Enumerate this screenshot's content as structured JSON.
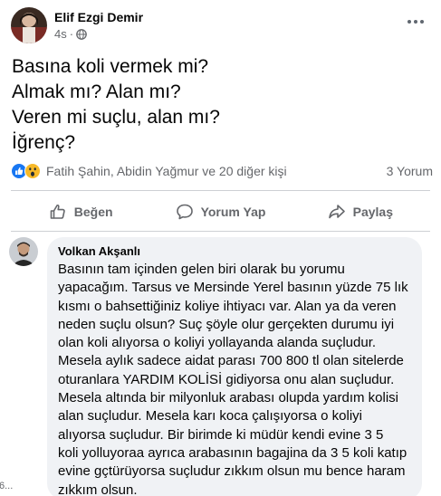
{
  "post": {
    "author": "Elif Ezgi Demir",
    "time": "4s",
    "separator": "·",
    "text_lines": [
      "Basına koli vermek mi?",
      "Almak mı? Alan mı?",
      "Veren mi suçlu, alan mı?",
      "İğrenç?"
    ]
  },
  "reactions": {
    "icons": [
      "like-reaction-icon",
      "wow-reaction-icon"
    ],
    "summary": "Fatih Şahin, Abidin Yağmur ve 20 diğer kişi",
    "comment_count": "3 Yorum"
  },
  "actions": {
    "like": "Beğen",
    "comment": "Yorum Yap",
    "share": "Paylaş"
  },
  "comment": {
    "author": "Volkan Akşanlı",
    "lines": [
      "Basının tam içinden gelen biri olarak bu yorumu",
      "yapacağım. Tarsus ve Mersinde Yerel basının yüzde 75 lık",
      "kısmı o bahsettiğiniz koliye ihtiyacı var. Alan ya da veren",
      "neden suçlu olsun? Suç şöyle olur gerçekten durumu iyi",
      "olan koli alıyorsa o koliyi yollayanda alanda suçludur.",
      "Mesela aylık sadece aidat parası 700 800 tl olan sitelerde",
      "oturanlara YARDIM KOLİSİ gidiyorsa onu alan suçludur.",
      "Mesela altında bir milyonluk arabası olupda yardım kolisi",
      "alan suçludur. Mesela karı koca çalışıyorsa o koliyi",
      "alıyorsa suçludur. Bir birimde ki müdür kendi evine 3 5",
      "koli yolluyoraa ayrıca arabasının bagajina da 3 5 koli katıp",
      "evine gçtürüyorsa suçludur zıkkım olsun mu bence haram",
      "zıkkım olsun."
    ]
  },
  "edge": {
    "cut_text": "6..."
  },
  "colors": {
    "like_blue": "#1877f2",
    "wow_yellow": "#f7b928",
    "secondary_text": "#65676b",
    "bubble_bg": "#f0f2f5"
  }
}
